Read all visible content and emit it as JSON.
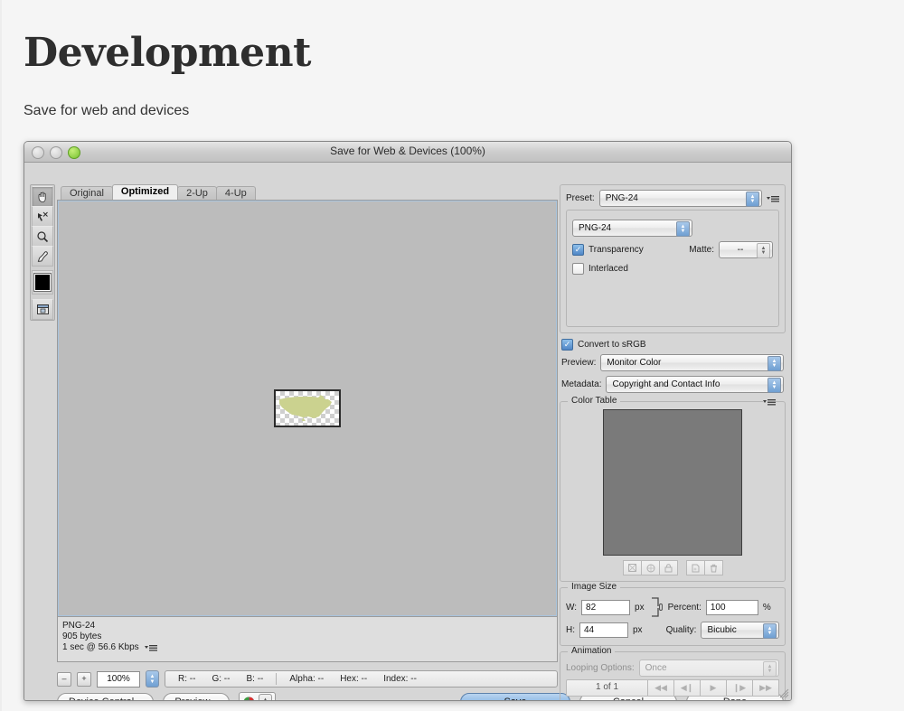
{
  "slide": {
    "title": "Development",
    "subtitle": "Save for web and devices"
  },
  "window": {
    "title": "Save for Web & Devices (100%)",
    "traffic_lights": [
      "close-disabled",
      "minimize-disabled",
      "zoom-green"
    ]
  },
  "tools": [
    {
      "name": "hand-tool",
      "selected": true
    },
    {
      "name": "slice-select-tool",
      "selected": false
    },
    {
      "name": "zoom-tool",
      "selected": false
    },
    {
      "name": "eyedropper-tool",
      "selected": false
    },
    {
      "name": "foreground-color-swatch",
      "color": "#000000"
    },
    {
      "name": "toggle-slices-visibility",
      "selected": false
    }
  ],
  "tabs": [
    {
      "label": "Original",
      "active": false
    },
    {
      "label": "Optimized",
      "active": true
    },
    {
      "label": "2-Up",
      "active": false
    },
    {
      "label": "4-Up",
      "active": false
    }
  ],
  "canvas": {
    "background_color": "#bcbcbc",
    "image_shape": "usa-map-silhouette",
    "image_color": "#cbd28f",
    "checker_light": "#ffffff",
    "checker_dark": "#cfcfcf"
  },
  "status": {
    "format": "PNG-24",
    "size": "905 bytes",
    "download_time": "1 sec @ 56.6 Kbps"
  },
  "zoombar": {
    "zoom_out": "–",
    "zoom_in": "+",
    "zoom_level": "100%",
    "readout": [
      {
        "label": "R:",
        "value": "--"
      },
      {
        "label": "G:",
        "value": "--"
      },
      {
        "label": "B:",
        "value": "--"
      }
    ],
    "readout2": [
      {
        "label": "Alpha:",
        "value": "--"
      },
      {
        "label": "Hex:",
        "value": "--"
      },
      {
        "label": "Index:",
        "value": "--"
      }
    ]
  },
  "buttons": {
    "device_central": "Device Central...",
    "preview": "Preview...",
    "save": "Save",
    "cancel": "Cancel",
    "done": "Done"
  },
  "settings": {
    "preset_label": "Preset:",
    "preset_value": "PNG-24",
    "format_value": "PNG-24",
    "transparency_label": "Transparency",
    "transparency_checked": true,
    "interlaced_label": "Interlaced",
    "interlaced_checked": false,
    "matte_label": "Matte:",
    "matte_value": "--",
    "convert_srgb_label": "Convert to sRGB",
    "convert_srgb_checked": true,
    "preview_label": "Preview:",
    "preview_value": "Monitor Color",
    "metadata_label": "Metadata:",
    "metadata_value": "Copyright and Contact Info"
  },
  "color_table": {
    "label": "Color Table",
    "tools": [
      "transparency-swatch-button",
      "web-shift-button",
      "lock-swatch-button",
      "new-swatch-button",
      "delete-swatch-button"
    ]
  },
  "image_size": {
    "label": "Image Size",
    "width_label": "W:",
    "width_value": "82",
    "width_unit": "px",
    "height_label": "H:",
    "height_value": "44",
    "height_unit": "px",
    "percent_label": "Percent:",
    "percent_value": "100",
    "percent_unit": "%",
    "quality_label": "Quality:",
    "quality_value": "Bicubic",
    "link_icon": "chain-link-icon"
  },
  "animation": {
    "label": "Animation",
    "looping_label": "Looping Options:",
    "looping_value": "Once",
    "frame_counter": "1 of 1",
    "controls": [
      "first-frame",
      "previous-frame",
      "play",
      "next-frame",
      "last-frame"
    ]
  }
}
